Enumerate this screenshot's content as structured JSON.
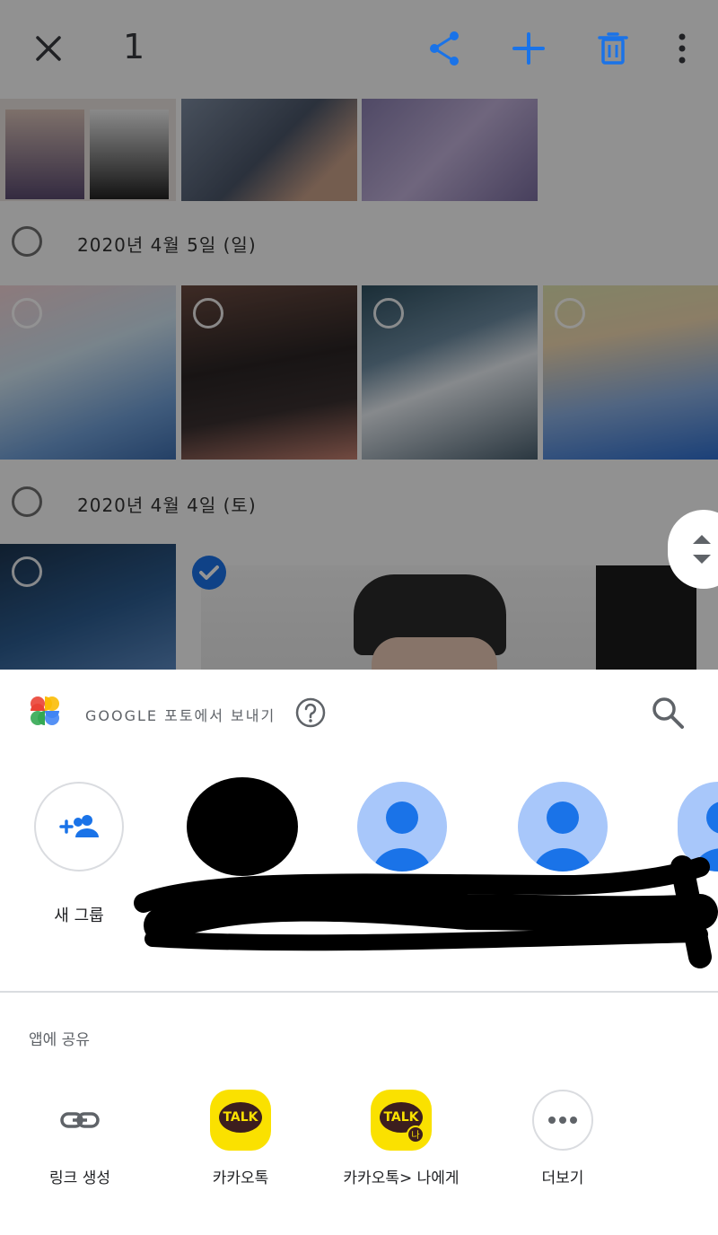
{
  "topbar": {
    "selected_count": "1",
    "close_icon": "close-icon",
    "share_icon": "share-icon",
    "add_icon": "add-icon",
    "delete_icon": "delete-icon",
    "more_icon": "more-vert-icon"
  },
  "grid": {
    "date_sections": [
      {
        "label": "2020년 4월 5일 (일)"
      },
      {
        "label": "2020년 4월 4일 (토)"
      }
    ]
  },
  "share_sheet": {
    "title": "GOOGLE 포토에서 보내기",
    "help_icon": "help-icon",
    "search_icon": "search-icon",
    "new_group_label": "새 그룹",
    "apps_header": "앱에 공유",
    "apps": [
      {
        "label": "링크 생성",
        "icon": "link-icon"
      },
      {
        "label": "카카오톡",
        "icon": "kakaotalk-icon"
      },
      {
        "label": "카카오톡> 나에게",
        "icon": "kakaotalk-me-icon"
      },
      {
        "label": "더보기",
        "icon": "more-horiz-icon"
      }
    ],
    "talk_text": "TALK",
    "talk_me_badge": "나"
  },
  "colors": {
    "accent_blue": "#1a73e8",
    "kakao_yellow": "#fae100",
    "kakao_brown": "#3c1e1e"
  }
}
